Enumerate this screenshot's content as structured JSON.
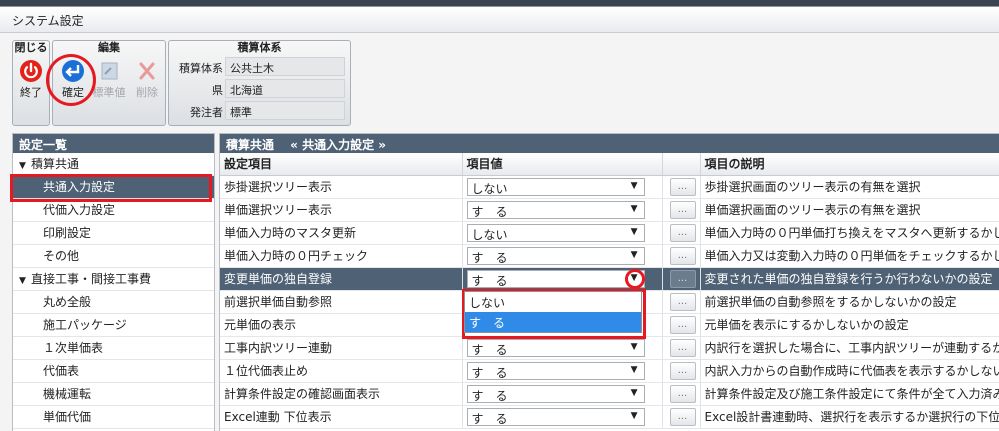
{
  "window": {
    "title": "システム設定"
  },
  "ribbon": {
    "close_group": {
      "title": "閉じる",
      "exit_label": "終了"
    },
    "edit_group": {
      "title": "編集",
      "confirm_label": "確定",
      "standard_label": "標準値",
      "delete_label": "削除"
    },
    "estimate_group": {
      "title": "積算体系",
      "rows": [
        {
          "label": "積算体系",
          "value": "公共土木"
        },
        {
          "label": "県",
          "value": "北海道"
        },
        {
          "label": "発注者",
          "value": "標準"
        }
      ]
    }
  },
  "sidebar": {
    "header": "設定一覧",
    "groups": [
      {
        "label": "積算共通",
        "items": [
          "共通入力設定",
          "代価入力設定",
          "印刷設定",
          "その他"
        ]
      },
      {
        "label": "直接工事・間接工事費",
        "items": [
          "丸め全般",
          "施工パッケージ",
          "１次単価表",
          "代価表",
          "機械運転",
          "単価代価"
        ]
      }
    ],
    "selected": "共通入力設定"
  },
  "main": {
    "breadcrumb": "積算共通　 « 共通入力設定 »",
    "columns": {
      "item": "設定項目",
      "value": "項目値",
      "desc": "項目の説明"
    },
    "button_label": "...",
    "rows": [
      {
        "item": "歩掛選択ツリー表示",
        "value": "しない",
        "desc": "歩掛選択画面のツリー表示の有無を選択"
      },
      {
        "item": "単価選択ツリー表示",
        "value": "す　る",
        "desc": "単価選択画面のツリー表示の有無を選択"
      },
      {
        "item": "単価入力時のマスタ更新",
        "value": "しない",
        "desc": "単価入力時の０円単価打ち換えをマスタへ更新するかし"
      },
      {
        "item": "単価入力時の０円チェック",
        "value": "す　る",
        "desc": "単価入力又は変動入力時の０円単価をチェックするかし"
      },
      {
        "item": "変更単価の独自登録",
        "value": "す　る",
        "desc": "変更された単価の独自登録を行うか行わないかの設定"
      },
      {
        "item": "前選択単価自動参照",
        "value": "",
        "desc": "前選択単価の自動参照をするかしないかの設定"
      },
      {
        "item": "元単価の表示",
        "value": "",
        "desc": "元単価を表示にするかしないかの設定"
      },
      {
        "item": "工事内訳ツリー連動",
        "value": "す　る",
        "desc": "内訳行を選択した場合に、工事内訳ツリーが連動するか"
      },
      {
        "item": "１位代価表止め",
        "value": "す　る",
        "desc": "内訳入力からの自動作成時に代価表を表示するかしない"
      },
      {
        "item": "計算条件設定の確認画面表示",
        "value": "す　る",
        "desc": "計算条件設定及び施工条件設定にて条件が全て入力済み"
      },
      {
        "item": "Excel連動 下位表示",
        "value": "す　る",
        "desc": "Excel設計書連動時、選択行を表示するか選択行の下位"
      }
    ],
    "dropdown_options": [
      "しない",
      "す　る"
    ],
    "dropdown_selected": "す　る"
  },
  "colors": {
    "header_bg": "#4f6275",
    "highlight": "#e5191f",
    "selection": "#2f8be7"
  }
}
